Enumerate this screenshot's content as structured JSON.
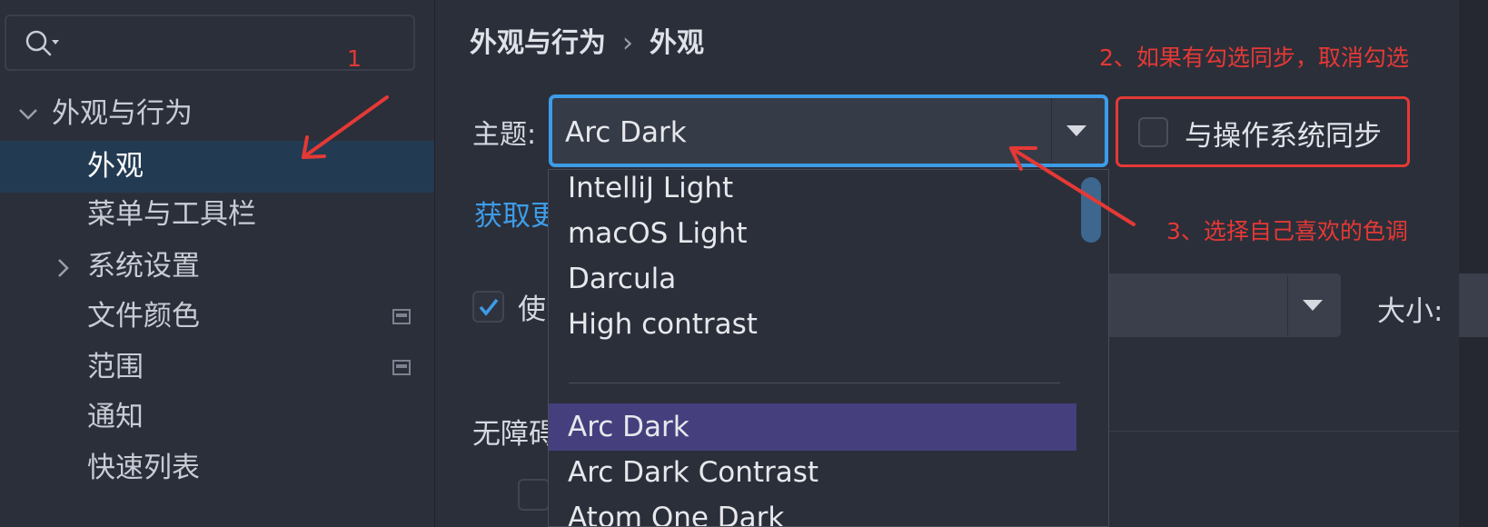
{
  "sidebar": {
    "search": {
      "placeholder": "",
      "icon": "search-icon"
    },
    "items": [
      {
        "label": "外观与行为",
        "expand": "expanded"
      },
      {
        "label": "外观",
        "selected": true
      },
      {
        "label": "菜单与工具栏"
      },
      {
        "label": "系统设置",
        "expand": "collapsed"
      },
      {
        "label": "文件颜色",
        "icon": "scope-icon"
      },
      {
        "label": "范围",
        "icon": "scope-icon"
      },
      {
        "label": "通知"
      },
      {
        "label": "快速列表"
      }
    ]
  },
  "breadcrumb": {
    "parent": "外观与行为",
    "separator": "›",
    "current": "外观"
  },
  "theme": {
    "label": "主题:",
    "value": "Arc Dark",
    "options": [
      "IntelliJ Light",
      "macOS Light",
      "Darcula",
      "High contrast",
      "Arc Dark",
      "Arc Dark Contrast",
      "Atom One Dark"
    ],
    "selected_option": "Arc Dark"
  },
  "sync": {
    "label": "与操作系统同步",
    "checked": false
  },
  "get_more_link": "获取更",
  "font": {
    "checkbox_label": "使",
    "checked": true,
    "value": "",
    "size_label": "大小:"
  },
  "accessibility": {
    "label": "无障碍"
  },
  "annotations": {
    "step1": "1",
    "step2": "2、如果有勾选同步，取消勾选",
    "step3": "3、选择自己喜欢的色调"
  },
  "colors": {
    "accent": "#3d9ce8",
    "selection_sidebar": "#233b52",
    "selection_dropdown": "#453f7d",
    "annotation": "#e53935",
    "background": "#2b2f3a"
  }
}
